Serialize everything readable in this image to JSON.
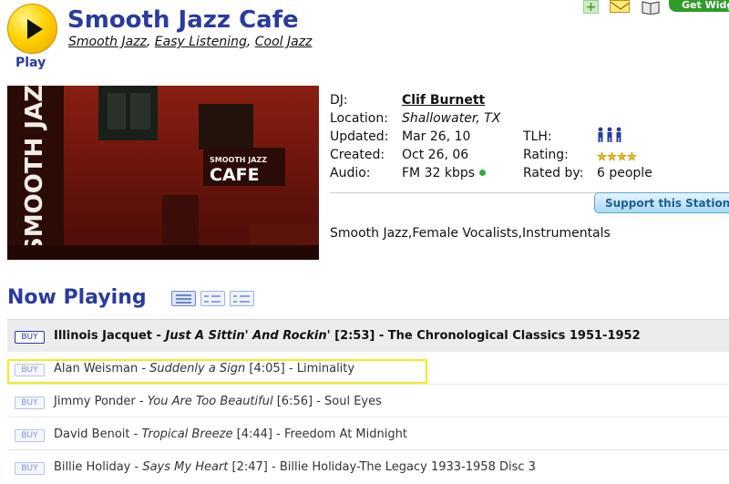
{
  "header": {
    "play_label": "Play",
    "station_title": "Smooth Jazz Cafe",
    "genres": [
      "Smooth Jazz",
      "Easy Listening",
      "Cool Jazz"
    ],
    "get_widget_label": "Get Widget",
    "image_sign_vertical": "SMOOTH JAZZ CAFE",
    "image_sign_small": "SMOOTH JAZZ",
    "image_sign_big": "CAFE"
  },
  "info": {
    "dj_label": "DJ:",
    "dj_value": "Clif Burnett",
    "location_label": "Location:",
    "location_value": "Shallowater, TX",
    "updated_label": "Updated:",
    "updated_value": "Mar 26, 10",
    "created_label": "Created:",
    "created_value": "Oct 26, 06",
    "audio_label": "Audio:",
    "audio_value": "FM 32 kbps",
    "tlh_label": "TLH:",
    "rating_label": "Rating:",
    "rating_stars": 4,
    "rated_by_label": "Rated by:",
    "rated_by_value": "6 people",
    "support_label": "Support this Station",
    "tags": "Smooth Jazz,Female Vocalists,Instrumentals"
  },
  "now_playing": {
    "title": "Now Playing",
    "buy_label": "BUY",
    "tracks": [
      {
        "artist": "Illinois Jacquet",
        "song": "Just A Sittin' And Rockin'",
        "duration": "[2:53]",
        "album": "The Chronological Classics 1951-1952"
      },
      {
        "artist": "Alan Weisman",
        "song": "Suddenly a Sign",
        "duration": "[4:05]",
        "album": "Liminality"
      },
      {
        "artist": "Jimmy Ponder",
        "song": "You Are Too Beautiful",
        "duration": "[6:56]",
        "album": "Soul Eyes"
      },
      {
        "artist": "David Benoit",
        "song": "Tropical Breeze",
        "duration": "[4:44]",
        "album": "Freedom At Midnight"
      },
      {
        "artist": "Billie Holiday",
        "song": "Says My Heart",
        "duration": "[2:47]",
        "album": "Billie Holiday-The Legacy 1933-1958 Disc 3"
      }
    ]
  },
  "colors": {
    "brand_blue": "#2a3b9c",
    "play_yellow": "#ffd200",
    "online_green": "#2dad2d",
    "highlight_yellow": "#f3ec1f"
  }
}
